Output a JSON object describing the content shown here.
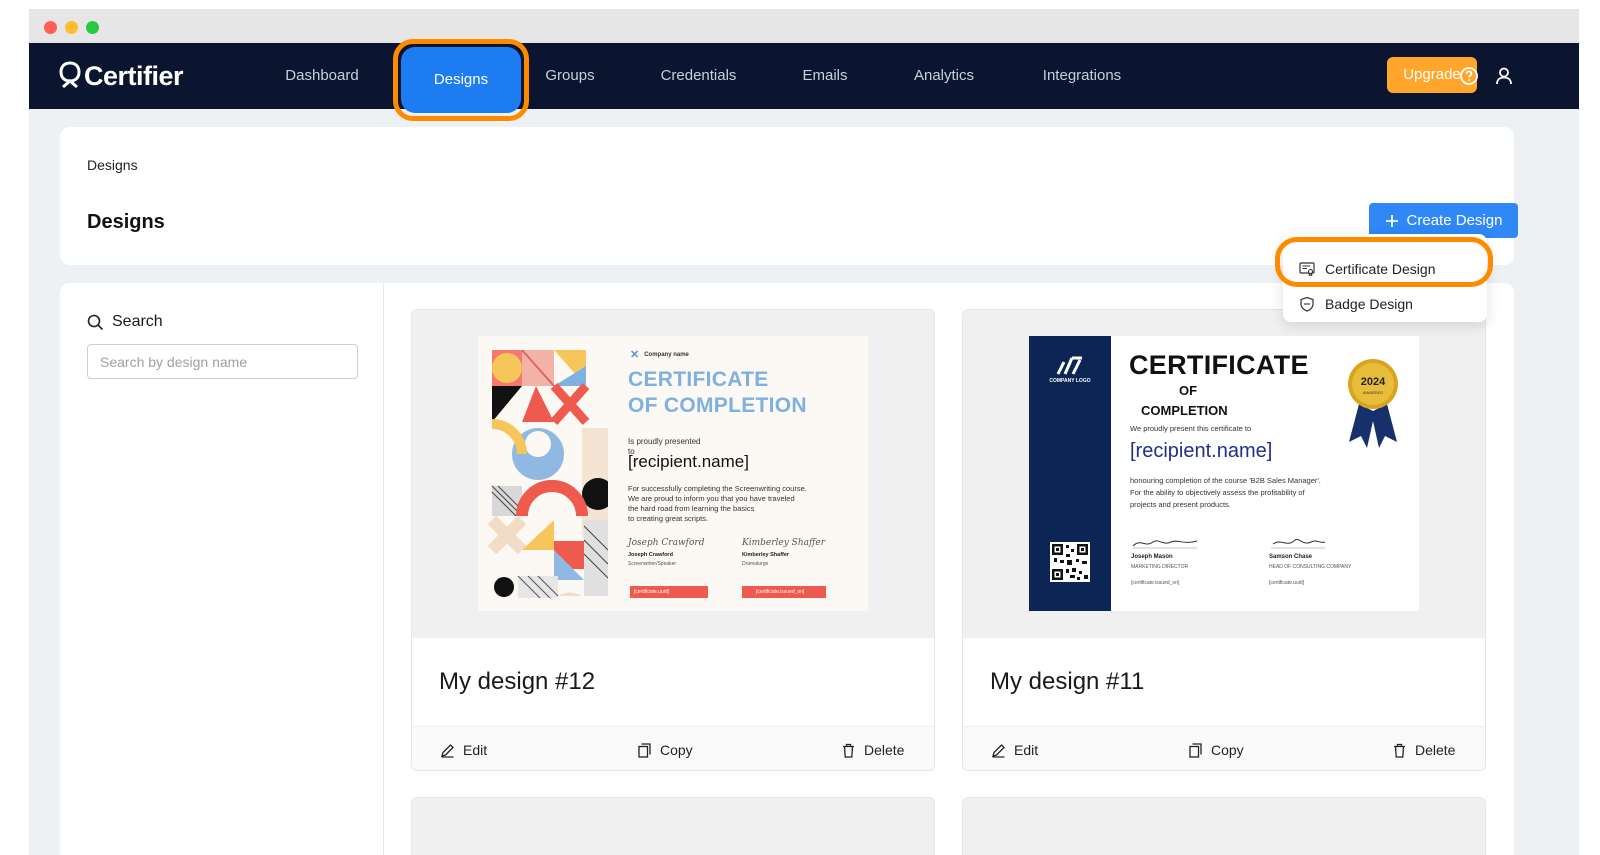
{
  "app": {
    "logo_text": "Certifier",
    "brand_colors": {
      "nav_bg": "#0b1530",
      "accent": "#1d7cf2",
      "upgrade": "#ffa62b",
      "highlight": "#ff8a00"
    }
  },
  "nav": {
    "items": [
      "Dashboard",
      "Designs",
      "Groups",
      "Credentials",
      "Emails",
      "Analytics",
      "Integrations"
    ],
    "active": "Designs",
    "upgrade_label": "Upgrade",
    "help_icon": "help-circle-icon",
    "user_icon": "user-icon"
  },
  "header": {
    "breadcrumb": "Designs",
    "title": "Designs",
    "create_label": "Create Design"
  },
  "dropdown": {
    "items": [
      {
        "label": "Certificate Design",
        "icon": "certificate-icon"
      },
      {
        "label": "Badge Design",
        "icon": "shield-icon"
      }
    ]
  },
  "sidebar": {
    "search_label": "Search",
    "search_placeholder": "Search by design name"
  },
  "designs": [
    {
      "name": "My design #12",
      "actions": [
        "Edit",
        "Copy",
        "Delete"
      ],
      "preview": {
        "company": "Company name",
        "title_line1": "CERTIFICATE",
        "title_line2": "OF COMPLETION",
        "presented": "Is proudly presented",
        "to": "to",
        "recipient": "[recipient.name]",
        "body1": "For successfully completing the Screenwriting course.",
        "body2": "We are proud to inform you that you have traveled",
        "body3": "the hard road from learning the basics",
        "body4": "to creating great scripts.",
        "sig1_script": "Joseph Crawford",
        "sig1_name": "Joseph Crawford",
        "sig1_role": "Screenwriter/Speaker",
        "sig2_script": "Kimberley Shaffer",
        "sig2_name": "Kimberley Shaffer",
        "sig2_role": "Dramaturge",
        "field1": "[certificate.uuid]",
        "field2": "[certificate.issued_on]"
      }
    },
    {
      "name": "My design #11",
      "actions": [
        "Edit",
        "Copy",
        "Delete"
      ],
      "preview": {
        "company": "COMPANY LOGO",
        "title_line1": "CERTIFICATE",
        "title_line2": "OF",
        "title_line3": "COMPLETION",
        "presented": "We proudly present this certificate to",
        "recipient": "[recipient.name]",
        "body1": "honouring completion of the course 'B2B Sales Manager'.",
        "body2": "For the ability to objectively assess the profitability of",
        "body3": "projects and present products.",
        "seal_year": "2024",
        "seal_text": "AWARDED",
        "sig1_name": "Joseph Mason",
        "sig1_role": "MARKETING DIRECTOR",
        "sig2_name": "Samson Chase",
        "sig2_role": "HEAD OF CONSULTING COMPANY",
        "field1": "[certificate.issued_on]",
        "field2": "[certificate.uuid]"
      }
    }
  ]
}
